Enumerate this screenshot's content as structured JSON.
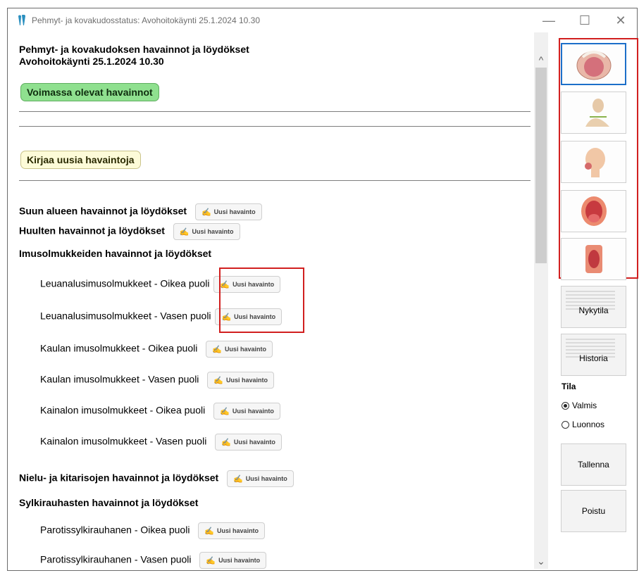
{
  "window": {
    "title": "Pehmyt- ja kovakudosstatus: Avohoitokäynti 25.1.2024 10.30",
    "min_glyph": "—",
    "max_glyph": "☐",
    "close_glyph": "✕"
  },
  "main": {
    "heading_line1": "Pehmyt- ja kovakudoksen havainnot ja löydökset",
    "heading_line2": "Avohoitokäynti 25.1.2024 10.30",
    "current_findings_label": "Voimassa olevat havainnot",
    "record_new_label": "Kirjaa uusia havaintoja",
    "new_finding_label": "Uusi havainto",
    "sections": {
      "mouth_area": "Suun alueen havainnot ja löydökset",
      "lips": "Huulten havainnot ja löydökset",
      "lymph_nodes": "Imusolmukkeiden havainnot ja löydökset",
      "pharynx_tonsils": "Nielu- ja kitarisojen havainnot ja löydökset",
      "salivary_glands": "Sylkirauhasten havainnot ja löydökset"
    },
    "subitems": {
      "submandibular_right": "Leuanalusimusolmukkeet - Oikea puoli",
      "submandibular_left": "Leuanalusimusolmukkeet - Vasen puoli",
      "neck_right": "Kaulan imusolmukkeet - Oikea puoli",
      "neck_left": "Kaulan imusolmukkeet - Vasen puoli",
      "axillary_right": "Kainalon imusolmukkeet - Oikea puoli",
      "axillary_left": "Kainalon imusolmukkeet - Vasen puoli",
      "parotid_right": "Parotissylkirauhanen - Oikea puoli",
      "parotid_left": "Parotissylkirauhanen - Vasen puoli"
    }
  },
  "sidebar": {
    "image_buttons": [
      "mouth-palate-image",
      "neck-lymph-image",
      "head-profile-image",
      "open-mouth-image",
      "oral-cavity-image"
    ],
    "current_state_button": "Nykytila",
    "history_button": "Historia",
    "state_label": "Tila",
    "state_options": [
      {
        "label": "Valmis",
        "selected": true
      },
      {
        "label": "Luonnos",
        "selected": false
      }
    ],
    "save_button": "Tallenna",
    "delete_button": "Poistu"
  },
  "colors": {
    "accent_selected": "#1c6fc9",
    "highlight_red": "#d11f1f",
    "green_pill": "#8fe08f",
    "yellow_pill": "#fdfbd8"
  }
}
